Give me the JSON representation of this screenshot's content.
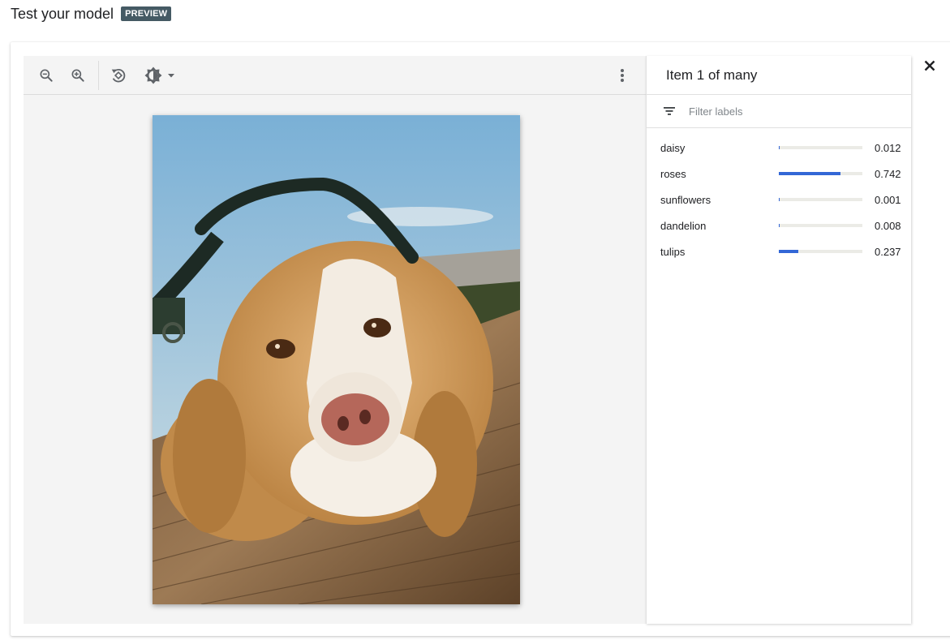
{
  "header": {
    "title": "Test your model",
    "badge": "PREVIEW"
  },
  "toolbar": {
    "buttons": [
      {
        "icon": "zoom-out-icon"
      },
      {
        "icon": "zoom-in-icon"
      },
      {
        "icon": "rotate-icon"
      },
      {
        "icon": "brightness-icon"
      },
      {
        "icon": "more-vert-icon"
      }
    ]
  },
  "panel": {
    "title": "Item 1 of many",
    "filter_placeholder": "Filter labels",
    "labels": [
      {
        "name": "daisy",
        "score": "0.012",
        "value": 0.012
      },
      {
        "name": "roses",
        "score": "0.742",
        "value": 0.742
      },
      {
        "name": "sunflowers",
        "score": "0.001",
        "value": 0.001
      },
      {
        "name": "dandelion",
        "score": "0.008",
        "value": 0.008
      },
      {
        "name": "tulips",
        "score": "0.237",
        "value": 0.237
      }
    ]
  },
  "colors": {
    "accent": "#3367d6",
    "badge": "#455a64",
    "track": "#ebebe6"
  }
}
